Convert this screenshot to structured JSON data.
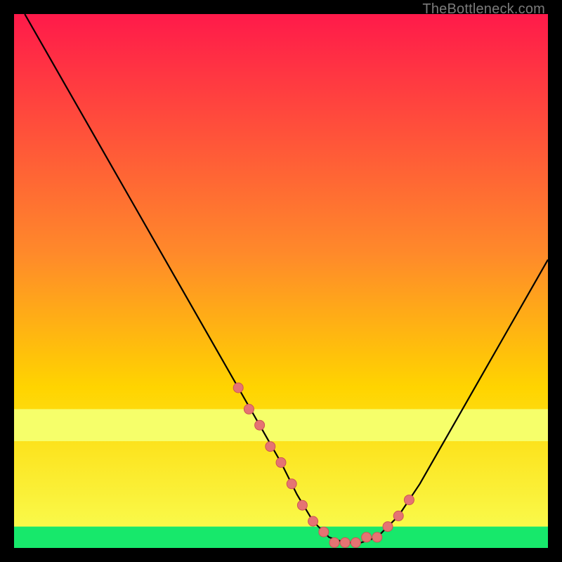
{
  "watermark": "TheBottleneck.com",
  "colors": {
    "frame_bg": "#000000",
    "gradient_top": "#ff1a4a",
    "gradient_mid": "#ffd400",
    "gradient_low_band": "#f6ff6a",
    "gradient_bottom": "#17e86b",
    "curve": "#000000",
    "marker_fill": "#e57373",
    "marker_stroke": "#cc5555"
  },
  "chart_data": {
    "type": "line",
    "title": "",
    "xlabel": "",
    "ylabel": "",
    "xlim": [
      0,
      100
    ],
    "ylim": [
      0,
      100
    ],
    "series": [
      {
        "name": "bottleneck-curve",
        "x": [
          2,
          6,
          10,
          14,
          18,
          22,
          26,
          30,
          34,
          38,
          42,
          46,
          50,
          53,
          56,
          59,
          62,
          65,
          68,
          72,
          76,
          80,
          84,
          88,
          92,
          96,
          100
        ],
        "y": [
          100,
          93,
          86,
          79,
          72,
          65,
          58,
          51,
          44,
          37,
          30,
          23,
          16,
          10,
          5,
          2,
          1,
          1,
          2,
          6,
          12,
          19,
          26,
          33,
          40,
          47,
          54
        ]
      }
    ],
    "markers": {
      "name": "highlight-points",
      "x": [
        42,
        44,
        46,
        48,
        50,
        52,
        54,
        56,
        58,
        60,
        62,
        64,
        66,
        68,
        70,
        72,
        74
      ],
      "y": [
        30,
        26,
        23,
        19,
        16,
        12,
        8,
        5,
        3,
        1,
        1,
        1,
        2,
        2,
        4,
        6,
        9
      ]
    },
    "bands": [
      {
        "name": "yellow-band",
        "y_from": 20,
        "y_to": 26
      },
      {
        "name": "green-band",
        "y_from": 0,
        "y_to": 4
      }
    ]
  }
}
